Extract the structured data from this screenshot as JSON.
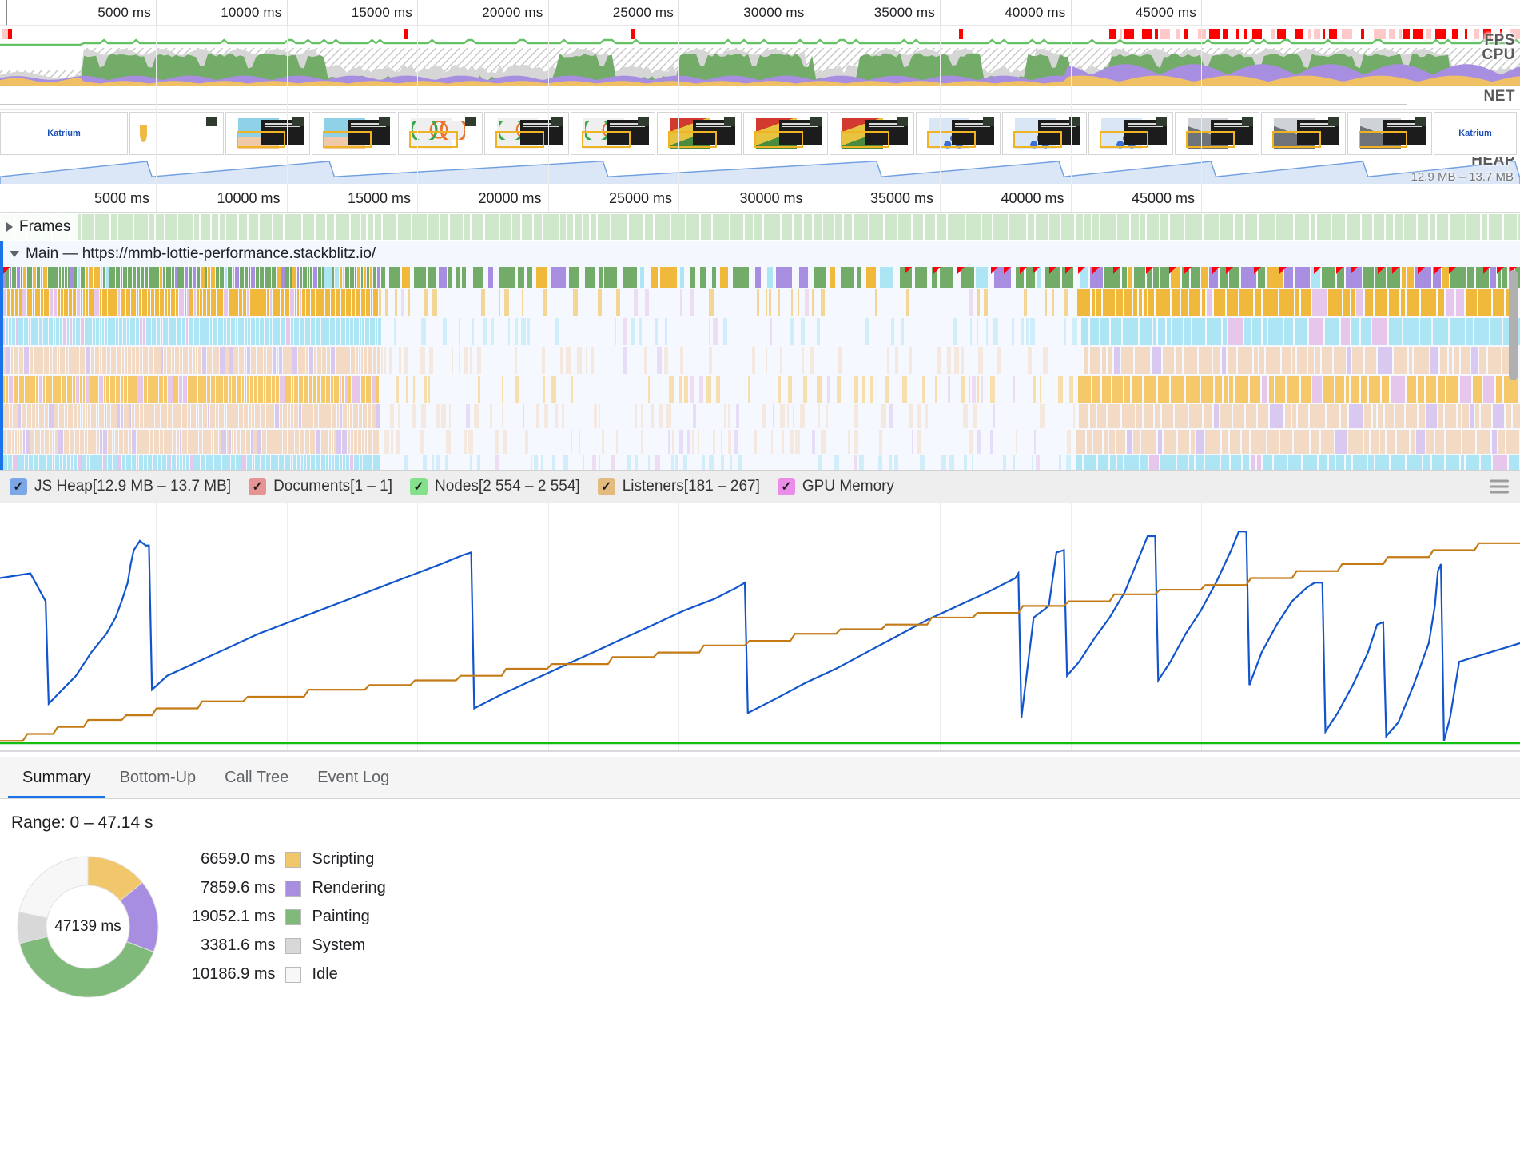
{
  "overview": {
    "ruler_top_ticks": [
      "5000 ms",
      "10000 ms",
      "15000 ms",
      "20000 ms",
      "25000 ms",
      "30000 ms",
      "35000 ms",
      "40000 ms",
      "45000 ms"
    ],
    "ruler_bottom_ticks": [
      "5000 ms",
      "10000 ms",
      "15000 ms",
      "20000 ms",
      "25000 ms",
      "30000 ms",
      "35000 ms",
      "40000 ms",
      "45000 ms"
    ],
    "band_labels": {
      "fps": "FPS",
      "cpu": "CPU",
      "net": "NET",
      "heap": "HEAP"
    },
    "heap_range": "12.9 MB – 13.7 MB",
    "filmstrip_brand": "Katrium"
  },
  "tracks": {
    "frames_label": "Frames",
    "frames_expand_icon": "triangle-right-icon",
    "main_label": "Main — https://mmb-lottie-performance.stackblitz.io/",
    "main_expand_icon": "triangle-down-icon"
  },
  "memory_legend": {
    "items": [
      {
        "label": "JS Heap[12.9 MB – 13.7 MB]",
        "color": "#7ba7e8",
        "checked": true,
        "name": "js-heap"
      },
      {
        "label": "Documents[1 – 1]",
        "color": "#e59393",
        "checked": true,
        "name": "documents"
      },
      {
        "label": "Nodes[2 554 – 2 554]",
        "color": "#85e08c",
        "checked": true,
        "name": "nodes"
      },
      {
        "label": "Listeners[181 – 267]",
        "color": "#e3bb7e",
        "checked": true,
        "name": "listeners"
      },
      {
        "label": "GPU Memory",
        "color": "#eb8ce8",
        "checked": true,
        "name": "gpu-memory"
      }
    ],
    "menu_icon": "hamburger-menu-icon"
  },
  "drawer": {
    "tabs": [
      {
        "label": "Summary",
        "active": true
      },
      {
        "label": "Bottom-Up",
        "active": false
      },
      {
        "label": "Call Tree",
        "active": false
      },
      {
        "label": "Event Log",
        "active": false
      }
    ],
    "range_text": "Range: 0 – 47.14 s"
  },
  "chart_data": {
    "type": "pie",
    "title": "Range: 0 – 47.14 s",
    "center_label": "47139 ms",
    "total_ms": 47139,
    "unit": "ms",
    "legend_position": "right",
    "categories": [
      "Scripting",
      "Rendering",
      "Painting",
      "System",
      "Idle"
    ],
    "values": [
      6659.0,
      7859.6,
      19052.1,
      3381.6,
      10186.9
    ],
    "value_labels": [
      "6659.0 ms",
      "7859.6 ms",
      "19052.1 ms",
      "3381.6 ms",
      "10186.9 ms"
    ],
    "colors": [
      "#f2c66a",
      "#a88ee0",
      "#7fba7a",
      "#d8d8d8",
      "#f7f7f7"
    ]
  },
  "memory_chart": {
    "type": "line",
    "xlabel": "",
    "ylabel": "",
    "grid": true,
    "series": [
      {
        "name": "JS Heap",
        "color": "#1155cc",
        "unit": "MB",
        "range": [
          12.9,
          13.7
        ],
        "points_pct": [
          [
            0,
            72
          ],
          [
            1,
            73
          ],
          [
            2,
            74
          ],
          [
            3,
            62
          ],
          [
            3.2,
            18
          ],
          [
            5,
            30
          ],
          [
            6,
            40
          ],
          [
            7,
            48
          ],
          [
            7.6,
            55
          ],
          [
            8,
            62
          ],
          [
            8.4,
            70
          ],
          [
            8.6,
            78
          ],
          [
            8.8,
            84
          ],
          [
            9.0,
            86
          ],
          [
            9.2,
            88
          ],
          [
            9.4,
            87
          ],
          [
            9.6,
            86
          ],
          [
            9.8,
            86
          ],
          [
            10,
            24
          ],
          [
            11,
            30
          ],
          [
            13,
            36
          ],
          [
            15,
            42
          ],
          [
            17,
            48
          ],
          [
            19,
            53
          ],
          [
            21,
            58
          ],
          [
            23,
            63
          ],
          [
            25,
            68
          ],
          [
            27,
            73
          ],
          [
            29,
            78
          ],
          [
            30.5,
            82
          ],
          [
            31,
            83
          ],
          [
            31.2,
            16
          ],
          [
            33,
            22
          ],
          [
            35,
            28
          ],
          [
            37,
            34
          ],
          [
            39,
            40
          ],
          [
            41,
            46
          ],
          [
            43,
            52
          ],
          [
            45,
            58
          ],
          [
            47,
            63
          ],
          [
            48.5,
            68
          ],
          [
            49,
            70
          ],
          [
            49.2,
            14
          ],
          [
            51,
            20
          ],
          [
            53,
            27
          ],
          [
            55,
            33
          ],
          [
            57,
            40
          ],
          [
            59,
            47
          ],
          [
            61,
            54
          ],
          [
            63,
            60
          ],
          [
            65,
            66
          ],
          [
            66.8,
            72
          ],
          [
            67,
            74
          ],
          [
            67.2,
            12
          ],
          [
            68,
            55
          ],
          [
            69,
            60
          ],
          [
            69.5,
            83
          ],
          [
            70,
            84
          ],
          [
            70.2,
            30
          ],
          [
            71,
            36
          ],
          [
            72,
            46
          ],
          [
            73,
            55
          ],
          [
            74,
            66
          ],
          [
            75,
            82
          ],
          [
            75.5,
            90
          ],
          [
            76,
            90
          ],
          [
            76.2,
            28
          ],
          [
            77,
            36
          ],
          [
            78,
            48
          ],
          [
            79,
            58
          ],
          [
            80,
            70
          ],
          [
            81,
            84
          ],
          [
            81.5,
            92
          ],
          [
            82,
            92
          ],
          [
            82.2,
            26
          ],
          [
            83,
            40
          ],
          [
            84,
            52
          ],
          [
            85,
            62
          ],
          [
            86,
            68
          ],
          [
            86.5,
            70
          ],
          [
            87,
            70
          ],
          [
            87.2,
            6
          ],
          [
            88,
            14
          ],
          [
            89,
            26
          ],
          [
            90,
            40
          ],
          [
            90.6,
            52
          ],
          [
            91,
            53
          ],
          [
            91.2,
            4
          ],
          [
            92,
            10
          ],
          [
            93,
            26
          ],
          [
            94,
            44
          ],
          [
            94.4,
            60
          ],
          [
            94.6,
            75
          ],
          [
            94.8,
            78
          ],
          [
            95,
            2
          ],
          [
            95.4,
            12
          ],
          [
            96,
            36
          ],
          [
            97,
            38
          ],
          [
            98,
            40
          ],
          [
            99,
            42
          ],
          [
            100,
            44
          ]
        ]
      },
      {
        "name": "Listeners",
        "color": "#c47b16",
        "unit": "count",
        "range": [
          181,
          267
        ],
        "points_pct": [
          [
            0,
            2
          ],
          [
            1.5,
            2
          ],
          [
            1.8,
            5
          ],
          [
            3.5,
            5
          ],
          [
            3.8,
            8
          ],
          [
            5.5,
            8
          ],
          [
            5.8,
            11
          ],
          [
            8,
            11
          ],
          [
            8.3,
            13
          ],
          [
            10,
            13
          ],
          [
            10.3,
            16
          ],
          [
            13,
            16
          ],
          [
            13.3,
            19
          ],
          [
            16,
            19
          ],
          [
            16.3,
            21
          ],
          [
            20,
            21
          ],
          [
            20.3,
            24
          ],
          [
            24,
            24
          ],
          [
            24.3,
            26
          ],
          [
            27,
            26
          ],
          [
            27.3,
            28
          ],
          [
            30,
            28
          ],
          [
            30.3,
            30
          ],
          [
            33,
            30
          ],
          [
            33.3,
            33
          ],
          [
            36,
            33
          ],
          [
            36.3,
            35
          ],
          [
            40,
            35
          ],
          [
            40.3,
            38
          ],
          [
            43,
            38
          ],
          [
            43.3,
            40
          ],
          [
            46,
            40
          ],
          [
            46.3,
            43
          ],
          [
            49,
            43
          ],
          [
            49.3,
            45
          ],
          [
            52,
            45
          ],
          [
            52.3,
            48
          ],
          [
            55,
            48
          ],
          [
            55.3,
            50
          ],
          [
            58,
            50
          ],
          [
            58.3,
            52
          ],
          [
            61,
            52
          ],
          [
            61.3,
            55
          ],
          [
            64,
            55
          ],
          [
            64.3,
            57
          ],
          [
            67,
            57
          ],
          [
            67.3,
            60
          ],
          [
            70,
            60
          ],
          [
            70.3,
            62
          ],
          [
            73,
            62
          ],
          [
            73.3,
            65
          ],
          [
            76,
            65
          ],
          [
            76.3,
            67
          ],
          [
            79,
            67
          ],
          [
            79.3,
            69
          ],
          [
            82,
            69
          ],
          [
            82.3,
            72
          ],
          [
            85,
            72
          ],
          [
            85.3,
            75
          ],
          [
            88,
            75
          ],
          [
            88.3,
            78
          ],
          [
            91,
            78
          ],
          [
            91.3,
            81
          ],
          [
            94,
            81
          ],
          [
            94.3,
            84
          ],
          [
            97,
            84
          ],
          [
            97.3,
            87
          ],
          [
            100,
            87
          ]
        ]
      },
      {
        "name": "Nodes",
        "color": "#14bf14",
        "unit": "count",
        "range": [
          2554,
          2554
        ],
        "points_pct": [
          [
            0,
            1
          ],
          [
            100,
            1
          ]
        ]
      }
    ]
  }
}
